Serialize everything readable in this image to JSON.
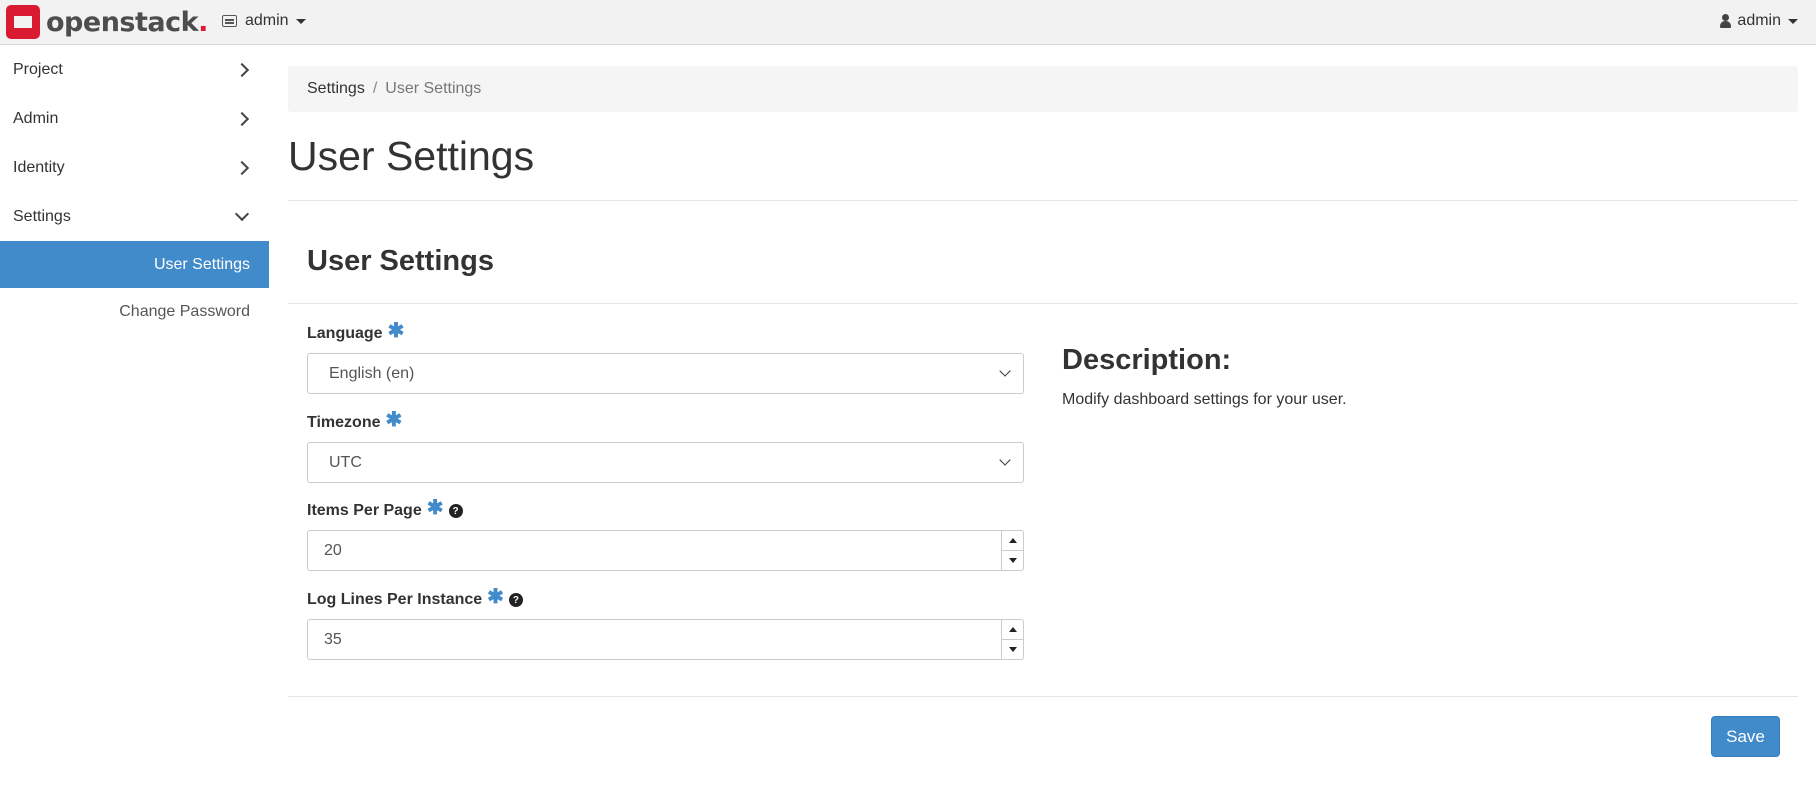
{
  "topbar": {
    "brand": "openstack",
    "brand_dot": ".",
    "project_label": "admin",
    "user_label": "admin"
  },
  "sidebar": {
    "items": [
      {
        "label": "Project",
        "expanded": false
      },
      {
        "label": "Admin",
        "expanded": false
      },
      {
        "label": "Identity",
        "expanded": false
      },
      {
        "label": "Settings",
        "expanded": true
      }
    ],
    "sub_items": [
      {
        "label": "User Settings",
        "active": true
      },
      {
        "label": "Change Password",
        "active": false
      }
    ]
  },
  "breadcrumb": {
    "parent": "Settings",
    "separator": "/",
    "current": "User Settings"
  },
  "page": {
    "title": "User Settings",
    "section_title": "User Settings"
  },
  "form": {
    "language": {
      "label": "Language",
      "required": "✱",
      "value": "English (en)"
    },
    "timezone": {
      "label": "Timezone",
      "required": "✱",
      "value": "UTC"
    },
    "items_per_page": {
      "label": "Items Per Page",
      "required": "✱",
      "help": "?",
      "value": "20"
    },
    "log_lines": {
      "label": "Log Lines Per Instance",
      "required": "✱",
      "help": "?",
      "value": "35"
    }
  },
  "description": {
    "title": "Description:",
    "text": "Modify dashboard settings for your user."
  },
  "actions": {
    "save_label": "Save"
  },
  "colors": {
    "accent": "#428bca",
    "brand_red": "#da1a32",
    "topbar_bg": "#f2f2f2"
  }
}
